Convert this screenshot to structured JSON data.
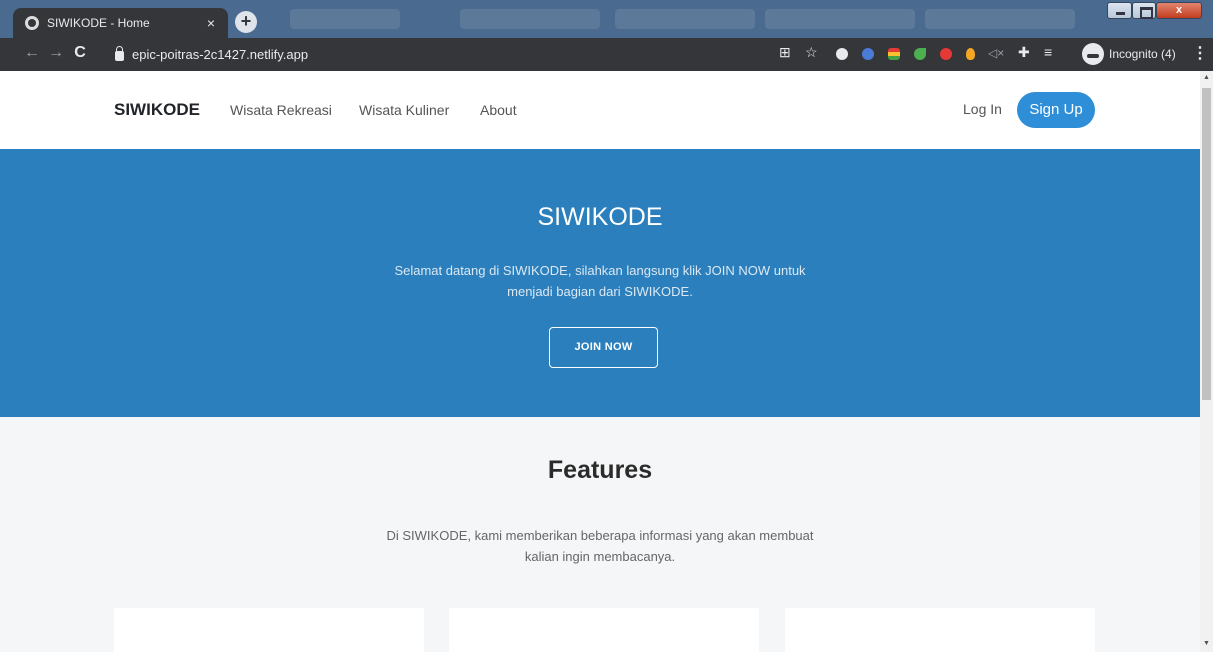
{
  "browser": {
    "tab_title": "SIWIKODE - Home",
    "tab_close": "×",
    "new_tab": "+",
    "close_window": "x",
    "url": "epic-poitras-2c1427.netlify.app",
    "incognito_label": "Incognito (4)"
  },
  "nav": {
    "brand": "SIWIKODE",
    "links": [
      "Wisata Rekreasi",
      "Wisata Kuliner",
      "About"
    ],
    "login": "Log In",
    "signup": "Sign Up"
  },
  "hero": {
    "title": "SIWIKODE",
    "text": "Selamat datang di SIWIKODE, silahkan langsung klik JOIN NOW untuk menjadi bagian dari SIWIKODE.",
    "button": "JOIN NOW"
  },
  "features": {
    "title": "Features",
    "text": "Di SIWIKODE, kami memberikan beberapa informasi yang akan membuat kalian ingin membacanya."
  },
  "colors": {
    "hero_bg": "#2b7fbc",
    "signup_bg": "#2e8fd8",
    "features_bg": "#f4f6f7"
  }
}
